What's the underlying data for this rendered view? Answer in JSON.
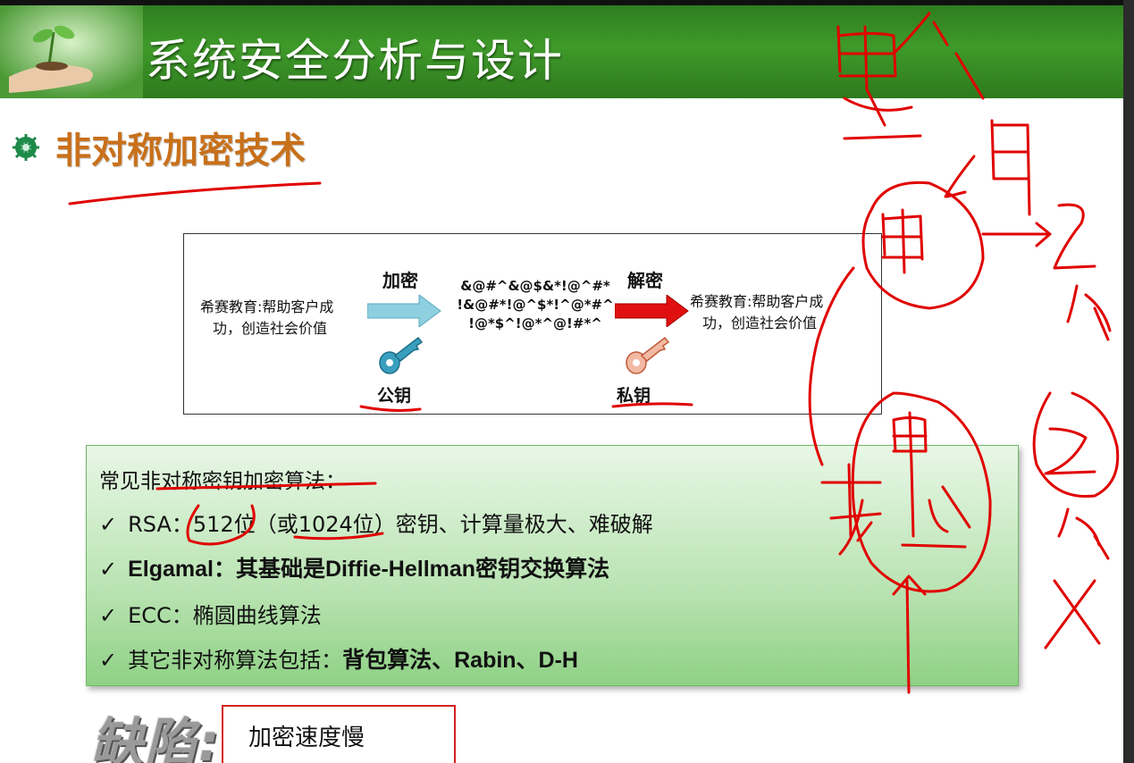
{
  "header": {
    "title": "系统安全分析与设计"
  },
  "section": {
    "title": "非对称加密技术",
    "bullet_icon": "gear-bullet-icon"
  },
  "diagram": {
    "plaintext_line1": "希赛教育:帮助客户成",
    "plaintext_line2": "功，创造社会价值",
    "encrypt_label": "加密",
    "decrypt_label": "解密",
    "cipher_line1": "&@#^&@$&*!@^#*",
    "cipher_line2": "!&@#*!@^$*!^@*#^",
    "cipher_line3": "!@*$^!@*^@!#*^",
    "result_line1": "希赛教育:帮助客户成",
    "result_line2": "功，创造社会价值",
    "public_key_label": "公钥",
    "private_key_label": "私钥"
  },
  "algorithms": {
    "heading": "常见非对称密钥加密算法：",
    "rows": [
      {
        "check": "✓",
        "text": "RSA：512位（或1024位）密钥、计算量极大、难破解"
      },
      {
        "check": "✓",
        "text": "Elgamal：其基础是Diffie-Hellman密钥交换算法"
      },
      {
        "check": "✓",
        "text": "ECC：椭圆曲线算法"
      },
      {
        "check": "✓",
        "text_prefix": "其它非对称算法包括：",
        "text_bold": "背包算法、Rabin、D-H"
      }
    ]
  },
  "defect": {
    "label": "缺陷:",
    "text": "加密速度慢"
  },
  "colors": {
    "header_green": "#3f9a2a",
    "section_orange": "#c8701a",
    "encrypt_arrow": "#8ecfe0",
    "decrypt_arrow": "#e01010",
    "public_key": "#3a9fbf",
    "private_key": "#e07a5a",
    "annotation_red": "#e00000"
  }
}
